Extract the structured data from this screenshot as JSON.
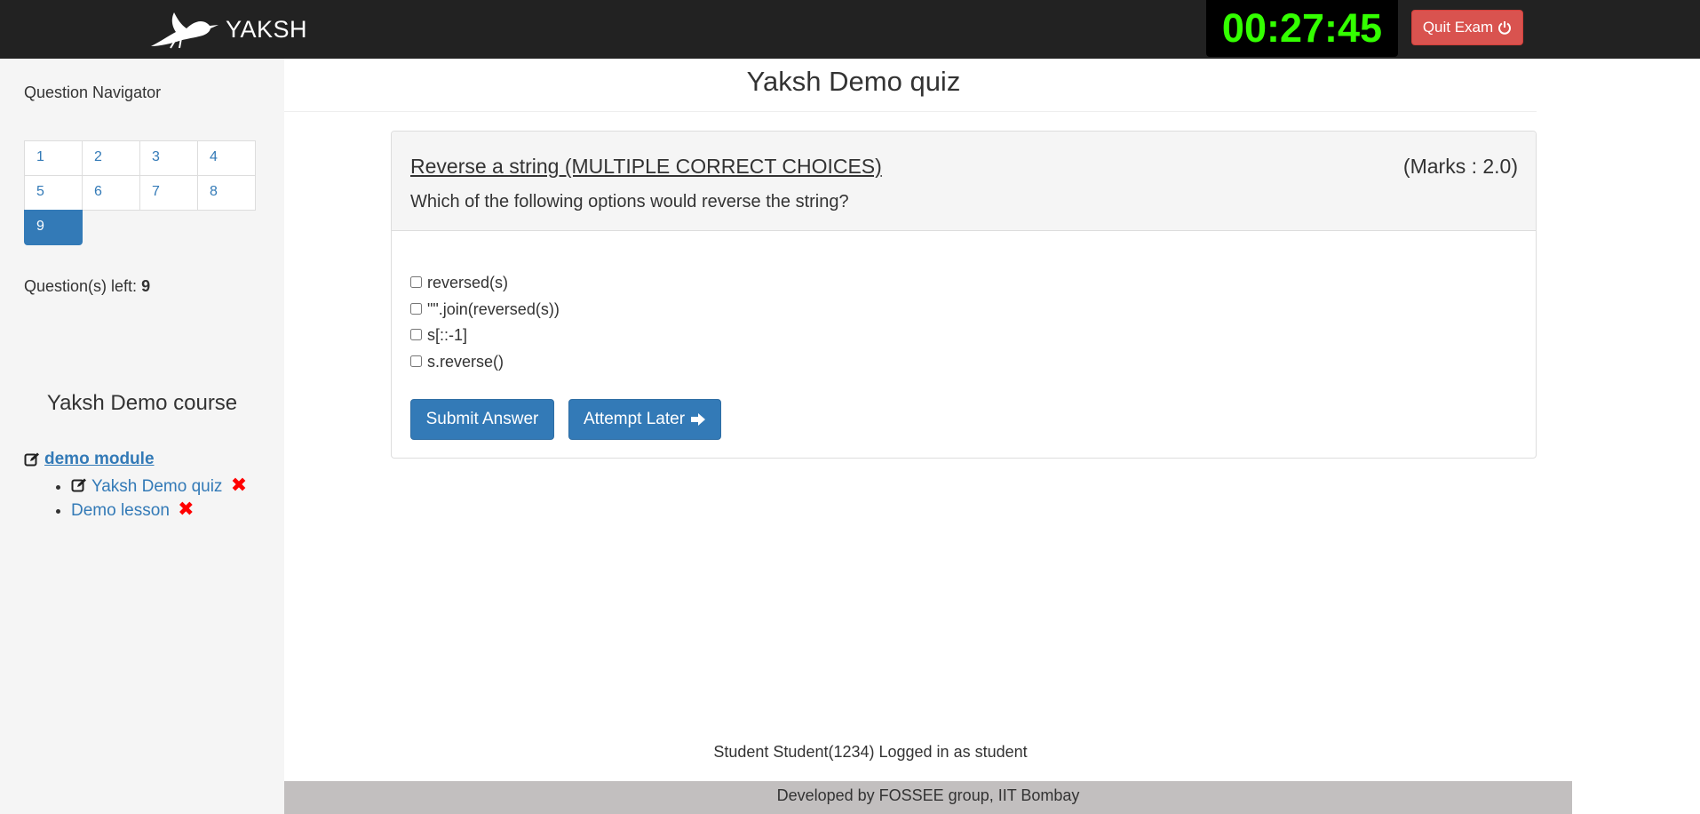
{
  "navbar": {
    "brand": "YAKSH",
    "timer": "00:27:45",
    "quit_label": "Quit Exam"
  },
  "sidebar": {
    "navigator_title": "Question Navigator",
    "questions": [
      "1",
      "2",
      "3",
      "4",
      "5",
      "6",
      "7",
      "8",
      "9"
    ],
    "active_question": "9",
    "questions_left_label": "Question(s) left:",
    "questions_left_value": "9",
    "course_title": "Yaksh Demo course",
    "module_name": "demo module",
    "units": [
      {
        "label": "Yaksh Demo quiz",
        "has_edit_icon": true,
        "status": "incomplete"
      },
      {
        "label": "Demo lesson",
        "has_edit_icon": false,
        "status": "incomplete"
      }
    ]
  },
  "main": {
    "quiz_title": "Yaksh Demo quiz",
    "question": {
      "summary": "Reverse a string (MULTIPLE CORRECT CHOICES)",
      "marks": "(Marks : 2.0)",
      "text": "Which of the following options would reverse the string?",
      "options": [
        "reversed(s)",
        "\"\".join(reversed(s))",
        "s[::-1]",
        "s.reverse()"
      ],
      "checked": [
        false,
        false,
        false,
        false
      ]
    },
    "submit_label": "Submit Answer",
    "attempt_later_label": "Attempt Later"
  },
  "status_line": "Student Student(1234) Logged in as student",
  "footer": "Developed by FOSSEE group, IIT Bombay",
  "colors": {
    "navbar": "#222222",
    "timer_text": "#33ff00",
    "danger": "#d9534f",
    "primary": "#337ab7",
    "cross": "#ff0000"
  }
}
